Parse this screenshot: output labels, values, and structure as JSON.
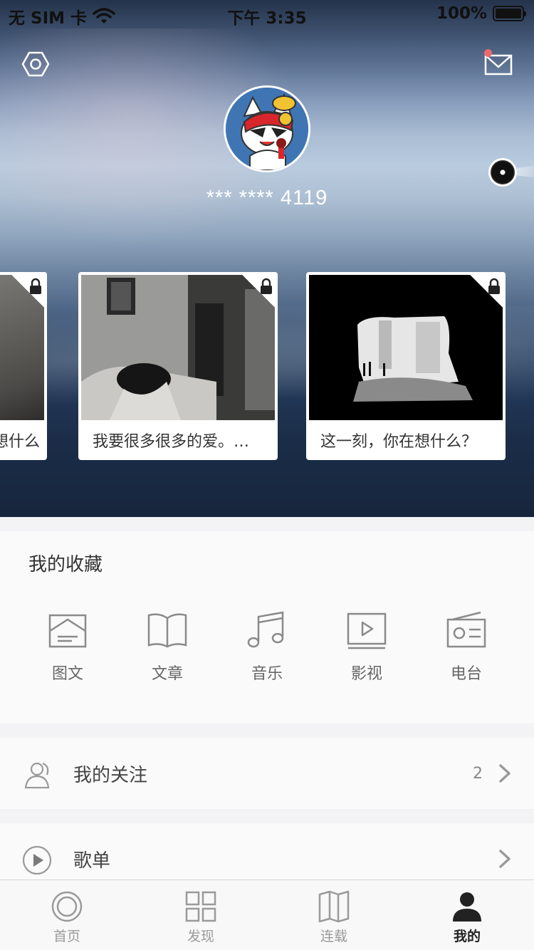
{
  "status_bar": {
    "carrier": "无 SIM 卡",
    "time": "下午 3:35",
    "battery": "100%"
  },
  "profile": {
    "username": "*** **** 4119"
  },
  "cards": [
    {
      "caption": "这一刻，你在想什么？",
      "locked": true
    },
    {
      "caption": "我要很多很多的爱。…",
      "locked": true
    },
    {
      "caption": "这一刻，你在想什么？",
      "locked": true
    }
  ],
  "collection": {
    "title": "我的收藏",
    "items": [
      {
        "label": "图文",
        "icon": "image-text-icon"
      },
      {
        "label": "文章",
        "icon": "book-icon"
      },
      {
        "label": "音乐",
        "icon": "music-note-icon"
      },
      {
        "label": "影视",
        "icon": "video-icon"
      },
      {
        "label": "电台",
        "icon": "radio-icon"
      }
    ]
  },
  "rows": {
    "following": {
      "label": "我的关注",
      "count": "2"
    },
    "playlist": {
      "label": "歌单"
    }
  },
  "tabbar": {
    "items": [
      {
        "label": "首页",
        "icon": "home-circle-icon",
        "active": false
      },
      {
        "label": "发现",
        "icon": "grid-icon",
        "active": false
      },
      {
        "label": "连载",
        "icon": "open-book-icon",
        "active": false
      },
      {
        "label": "我的",
        "icon": "person-icon",
        "active": true
      }
    ]
  },
  "colors": {
    "notification_dot": "#ee6a6a",
    "active_tab": "#222222",
    "inactive_tab": "#9a9a9a"
  }
}
